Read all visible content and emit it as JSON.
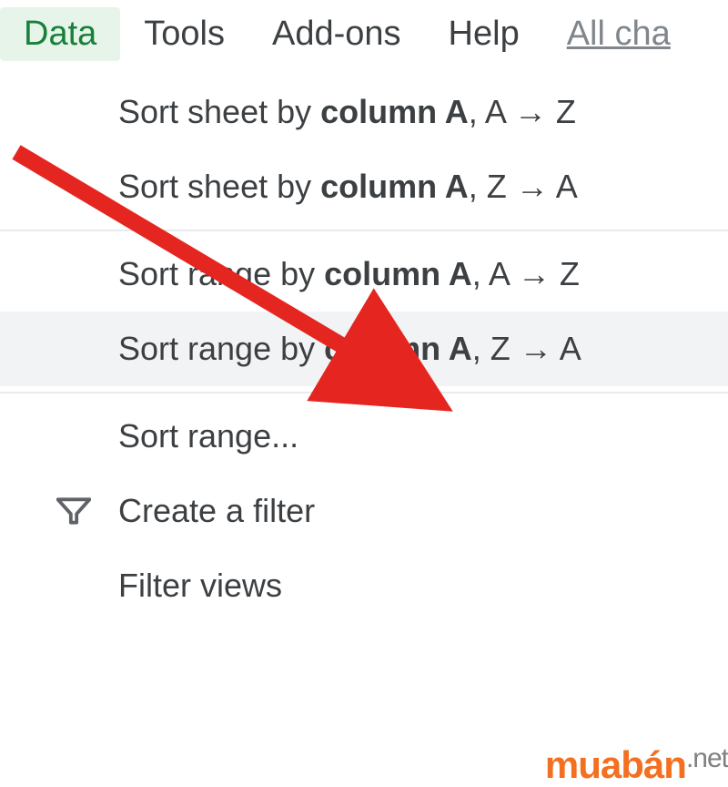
{
  "menubar": {
    "data": "Data",
    "tools": "Tools",
    "addons": "Add-ons",
    "help": "Help",
    "allchanges": "All cha"
  },
  "menu": {
    "sort_sheet_az_pre": "Sort sheet by ",
    "sort_sheet_az_bold": "column A",
    "sort_sheet_az_post": ", A → Z",
    "sort_sheet_za_pre": "Sort sheet by ",
    "sort_sheet_za_bold": "column A",
    "sort_sheet_za_post": ", Z → A",
    "sort_range_az_pre": "Sort range by ",
    "sort_range_az_bold": "column A",
    "sort_range_az_post": ", A → Z",
    "sort_range_za_pre": "Sort range by ",
    "sort_range_za_bold": "column A",
    "sort_range_za_post": ", Z → A",
    "sort_range": "Sort range...",
    "create_filter": "Create a filter",
    "filter_views": "Filter views"
  },
  "watermark": {
    "brand": "muabán",
    "tld": ".net"
  },
  "annotation": {
    "arrow_color": "#e52620"
  }
}
